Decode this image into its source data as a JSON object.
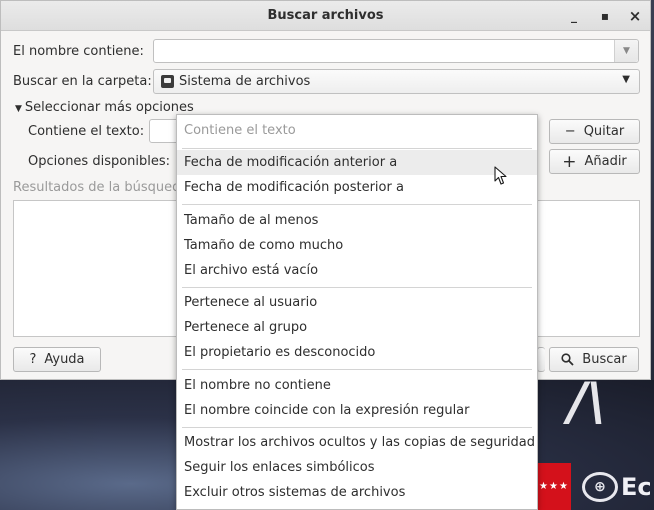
{
  "window": {
    "title": "Buscar archivos",
    "minimize_glyph": "_",
    "maximize_glyph": "▪",
    "close_glyph": "×"
  },
  "form": {
    "name_label": "El nombre contiene:",
    "name_value": "",
    "folder_label": "Buscar en la carpeta:",
    "folder_value": "Sistema de archivos",
    "folder_icon": "drive-icon",
    "more_options_label": "Seleccionar más opciones",
    "contains_text_label": "Contiene el texto:",
    "available_options_label": "Opciones disponibles:",
    "results_label": "Resultados de la búsqueda"
  },
  "buttons": {
    "remove": "Quitar",
    "remove_icon": "−",
    "add": "Añadir",
    "add_icon": "+",
    "help": "Ayuda",
    "help_icon": "?",
    "search": "Buscar",
    "search_icon": "search-icon"
  },
  "menu": {
    "placeholder": "Contiene el texto",
    "hovered_index": 0,
    "groups": [
      [
        "Fecha de modificación anterior a",
        "Fecha de modificación posterior a"
      ],
      [
        "Tamaño de al menos",
        "Tamaño de como mucho",
        "El archivo está vacío"
      ],
      [
        "Pertenece al usuario",
        "Pertenece al grupo",
        "El propietario es desconocido"
      ],
      [
        "El nombre no contiene",
        "El nombre coincide con la expresión regular"
      ],
      [
        "Mostrar los archivos ocultos y las copias de seguridad",
        "Seguir los enlaces simbólicos",
        "Excluir otros sistemas de archivos"
      ]
    ]
  },
  "colors": {
    "window_bg": "#f6f5f4",
    "menu_hover": "#ececec",
    "desktop_red": "#d4111b"
  }
}
